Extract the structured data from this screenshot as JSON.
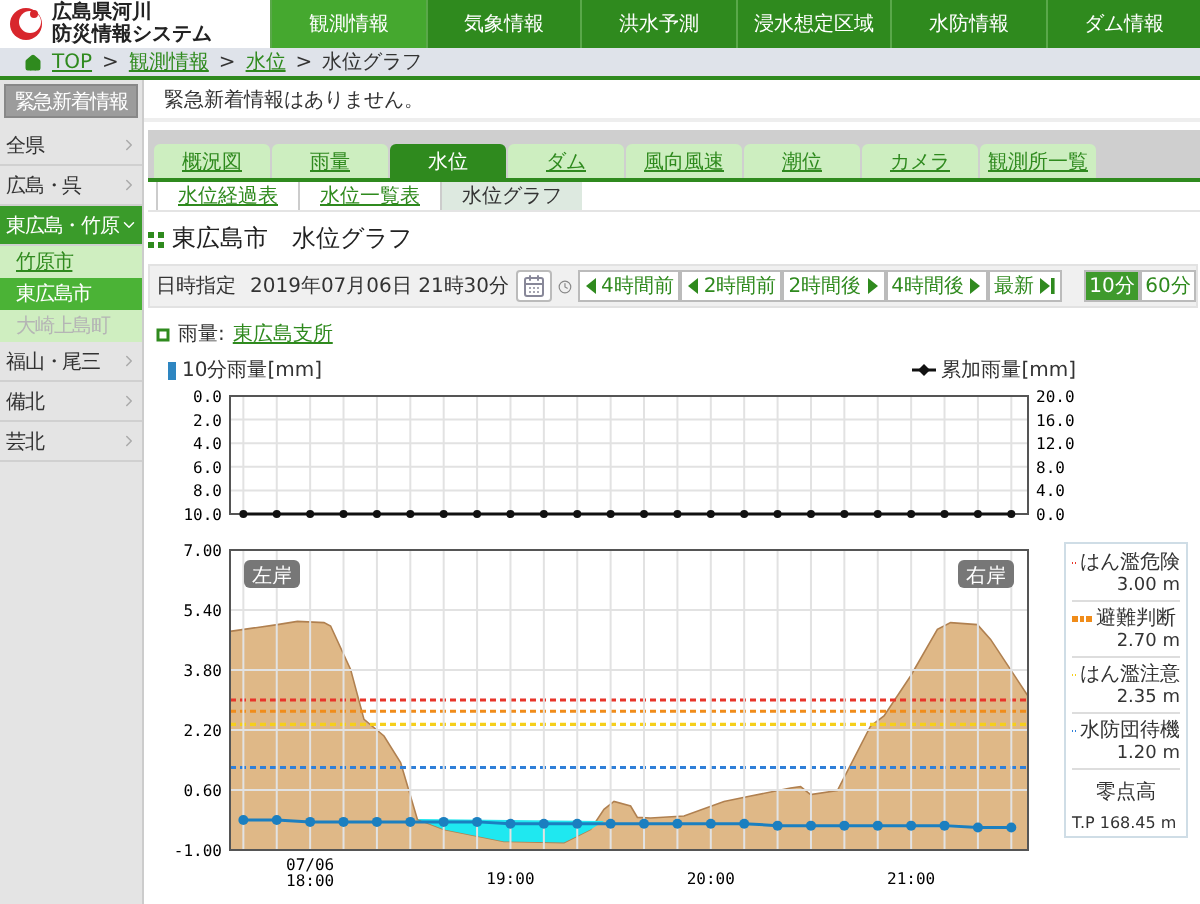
{
  "header": {
    "logo_lines": [
      "広島県河川",
      "防災情報システム"
    ],
    "nav": [
      {
        "label": "観測情報",
        "selected": true
      },
      {
        "label": "気象情報",
        "selected": false
      },
      {
        "label": "洪水予測",
        "selected": false
      },
      {
        "label": "浸水想定区域",
        "selected": false
      },
      {
        "label": "水防情報",
        "selected": false
      },
      {
        "label": "ダム情報",
        "selected": false
      }
    ]
  },
  "breadcrumb": {
    "separator": ">",
    "items": [
      {
        "label": "TOP",
        "kind": "home"
      },
      {
        "label": "観測情報",
        "kind": "link"
      },
      {
        "label": "水位",
        "kind": "link"
      },
      {
        "label": "水位グラフ",
        "kind": "current"
      }
    ]
  },
  "emergency": {
    "button": "緊急新着情報",
    "message": "緊急新着情報はありません。"
  },
  "sidebar": {
    "items": [
      {
        "label": "全県",
        "expanded": false
      },
      {
        "label": "広島・呉",
        "expanded": false
      },
      {
        "label": "東広島・竹原",
        "expanded": true,
        "children": [
          {
            "label": "竹原市",
            "selected": false,
            "disabled": false
          },
          {
            "label": "東広島市",
            "selected": true,
            "disabled": false
          },
          {
            "label": "大崎上島町",
            "selected": false,
            "disabled": true
          }
        ]
      },
      {
        "label": "福山・尾三",
        "expanded": false
      },
      {
        "label": "備北",
        "expanded": false
      },
      {
        "label": "芸北",
        "expanded": false
      }
    ]
  },
  "tabs": [
    {
      "label": "概況図",
      "selected": false
    },
    {
      "label": "雨量",
      "selected": false
    },
    {
      "label": "水位",
      "selected": true
    },
    {
      "label": "ダム",
      "selected": false
    },
    {
      "label": "風向風速",
      "selected": false
    },
    {
      "label": "潮位",
      "selected": false
    },
    {
      "label": "カメラ",
      "selected": false
    },
    {
      "label": "観測所一覧",
      "selected": false
    }
  ],
  "subtabs": [
    {
      "label": "水位経過表",
      "selected": false
    },
    {
      "label": "水位一覧表",
      "selected": false
    },
    {
      "label": "水位グラフ",
      "selected": true
    }
  ],
  "title": "東広島市　水位グラフ",
  "date_bar": {
    "label": "日時指定",
    "value": "2019年07月06日 21時30分",
    "steps": [
      {
        "label": "4時間前",
        "kind": "prev"
      },
      {
        "label": "2時間前",
        "kind": "prev"
      },
      {
        "label": "2時間後",
        "kind": "next"
      },
      {
        "label": "4時間後",
        "kind": "next"
      },
      {
        "label": "最新",
        "kind": "latest"
      }
    ],
    "intervals": [
      {
        "label": "10分",
        "selected": true
      },
      {
        "label": "60分",
        "selected": false
      }
    ]
  },
  "rain": {
    "label": "雨量:",
    "station": "東広島支所",
    "chart_data": {
      "type": "bar",
      "x": [
        1060,
        1070,
        1080,
        1090,
        1100,
        1110,
        1120,
        1130,
        1140,
        1150,
        1160,
        1170,
        1180,
        1190,
        1200,
        1210,
        1220,
        1230,
        1240,
        1250,
        1260,
        1270,
        1280,
        1290
      ],
      "xlim": [
        1056,
        1295
      ],
      "series": [
        {
          "name": "10分雨量[mm]",
          "color": "#2e86c1",
          "values": [
            0,
            0,
            0,
            0,
            0,
            0,
            0,
            0,
            0,
            0,
            0,
            0,
            0,
            0,
            0,
            0,
            0,
            0,
            0,
            0,
            0,
            0,
            0,
            0
          ]
        },
        {
          "name": "累加雨量[mm]",
          "color": "#111111",
          "values": [
            0,
            0,
            0,
            0,
            0,
            0,
            0,
            0,
            0,
            0,
            0,
            0,
            0,
            0,
            0,
            0,
            0,
            0,
            0,
            0,
            0,
            0,
            0,
            0
          ]
        }
      ],
      "ylim": [
        10,
        0
      ],
      "grid": true,
      "yticks": [
        {
          "value": 0,
          "label": "0.0"
        },
        {
          "value": 2,
          "label": "2.0"
        },
        {
          "value": 4,
          "label": "4.0"
        },
        {
          "value": 6,
          "label": "6.0"
        },
        {
          "value": 8,
          "label": "8.0"
        },
        {
          "value": 10,
          "label": "10.0"
        }
      ],
      "y2lim": [
        0,
        20
      ],
      "y2ticks": [
        {
          "value": 20,
          "label": "20.0"
        },
        {
          "value": 16,
          "label": "16.0"
        },
        {
          "value": 12,
          "label": "12.0"
        },
        {
          "value": 8,
          "label": "8.0"
        },
        {
          "value": 4,
          "label": "4.0"
        },
        {
          "value": 0,
          "label": "0.0"
        }
      ]
    }
  },
  "water": {
    "banks": [
      "左岸",
      "右岸"
    ],
    "chart_data": {
      "type": "line",
      "x": [
        1060,
        1070,
        1080,
        1090,
        1100,
        1110,
        1120,
        1130,
        1140,
        1150,
        1160,
        1170,
        1180,
        1190,
        1200,
        1210,
        1220,
        1230,
        1240,
        1250,
        1260,
        1270,
        1280,
        1290
      ],
      "xlim": [
        1056,
        1295
      ],
      "xticks": [
        {
          "value": 1080,
          "label": "07/06 18:00"
        },
        {
          "value": 1140,
          "label": "19:00"
        },
        {
          "value": 1200,
          "label": "20:00"
        },
        {
          "value": 1260,
          "label": "21:00"
        }
      ],
      "grid": true,
      "series": [
        {
          "color": "#1b7fc0",
          "marker": "circle",
          "values": [
            -0.2,
            -0.2,
            -0.25,
            -0.25,
            -0.25,
            -0.25,
            -0.25,
            -0.25,
            -0.3,
            -0.3,
            -0.3,
            -0.3,
            -0.3,
            -0.3,
            -0.3,
            -0.3,
            -0.35,
            -0.35,
            -0.35,
            -0.35,
            -0.35,
            -0.35,
            -0.4,
            -0.4
          ]
        }
      ],
      "ylim": [
        -1,
        7
      ],
      "yticks": [
        {
          "value": 7,
          "label": "7.00"
        },
        {
          "value": 5.4,
          "label": "5.40"
        },
        {
          "value": 3.8,
          "label": "3.80"
        },
        {
          "value": 2.2,
          "label": "2.20"
        },
        {
          "value": 0.6,
          "label": "0.60"
        },
        {
          "value": -1,
          "label": "-1.00"
        }
      ]
    },
    "legend": {
      "thresholds": [
        {
          "name": "はん濫危険",
          "value": "3.00 m",
          "color": "#e8352a"
        },
        {
          "name": "避難判断",
          "value": "2.70 m",
          "color": "#f08c1a"
        },
        {
          "name": "はん濫注意",
          "value": "2.35 m",
          "color": "#f5cf1c"
        },
        {
          "name": "水防団待機",
          "value": "1.20 m",
          "color": "#2f7fd8"
        }
      ],
      "elevation": {
        "label": "零点高",
        "value": "T.P 168.45 m"
      }
    }
  }
}
